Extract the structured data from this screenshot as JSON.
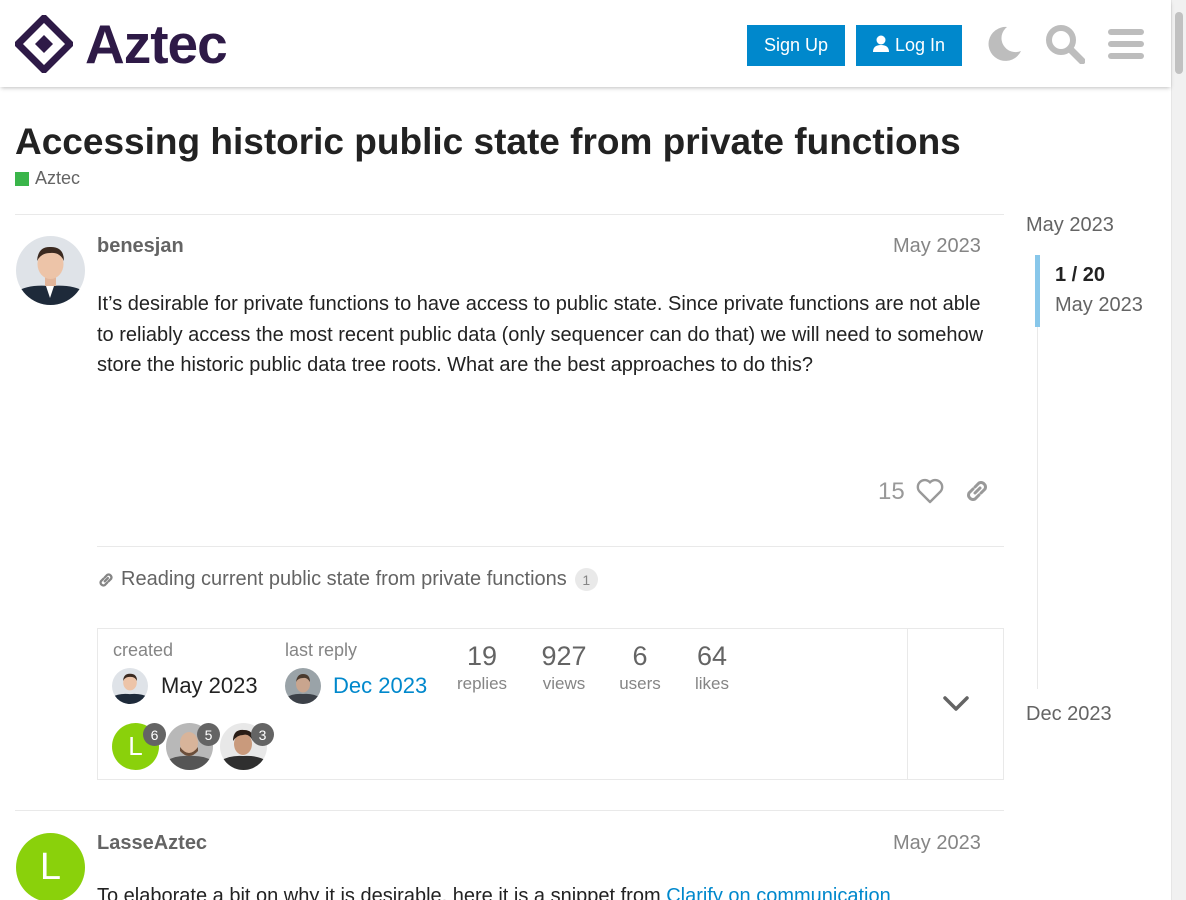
{
  "brand": {
    "name": "Aztec"
  },
  "header": {
    "signup_label": "Sign Up",
    "login_label": "Log In",
    "icons": [
      "moon-icon",
      "search-icon",
      "menu-icon"
    ]
  },
  "topic": {
    "title": "Accessing historic public state from private functions",
    "category": "Aztec",
    "category_color": "#3ab54a"
  },
  "posts": [
    {
      "username": "benesjan",
      "date": "May 2023",
      "body": "It’s desirable for private functions to have access to public state. Since private functions are not able to reliably access the most recent public data (only sequencer can do that) we will need to somehow store the historic public data tree roots. What are the best approaches to do this?",
      "likes": "15"
    },
    {
      "username": "LasseAztec",
      "date": "May 2023",
      "avatar_letter": "L",
      "body_prefix": "To elaborate a bit on why it is desirable, here it is a snippet from ",
      "body_link": "Clarify on communication"
    }
  ],
  "linked_topic": {
    "title": "Reading current public state from private functions",
    "count": "1"
  },
  "summary": {
    "created_label": "created",
    "created_date": "May 2023",
    "last_reply_label": "last reply",
    "last_reply_date": "Dec 2023",
    "stats": [
      {
        "value": "19",
        "label": "replies"
      },
      {
        "value": "927",
        "label": "views"
      },
      {
        "value": "6",
        "label": "users"
      },
      {
        "value": "64",
        "label": "likes"
      }
    ],
    "participants": [
      {
        "letter": "L",
        "count": "6"
      },
      {
        "letter": "",
        "count": "5"
      },
      {
        "letter": "",
        "count": "3"
      }
    ]
  },
  "timeline": {
    "start": "May 2023",
    "position": "1 / 20",
    "position_date": "May 2023",
    "end": "Dec 2023"
  },
  "colors": {
    "accent": "#0088cc",
    "brand": "#2e1a47",
    "timeline_handle": "#88c7ea",
    "avatar_green": "#8ad10b"
  }
}
